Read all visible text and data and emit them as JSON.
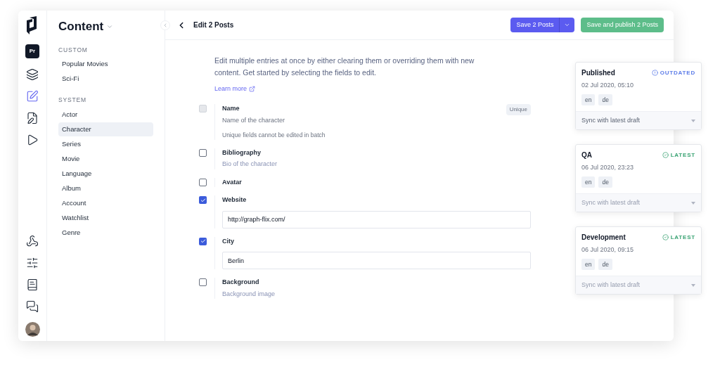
{
  "project_badge": "Pr",
  "nav": {
    "title": "Content",
    "sections": [
      {
        "heading": "CUSTOM",
        "items": [
          {
            "label": "Popular Movies",
            "selected": false
          },
          {
            "label": "Sci-Fi",
            "selected": false
          }
        ]
      },
      {
        "heading": "SYSTEM",
        "items": [
          {
            "label": "Actor",
            "selected": false
          },
          {
            "label": "Character",
            "selected": true
          },
          {
            "label": "Series",
            "selected": false
          },
          {
            "label": "Movie",
            "selected": false
          },
          {
            "label": "Language",
            "selected": false
          },
          {
            "label": "Album",
            "selected": false
          },
          {
            "label": "Account",
            "selected": false
          },
          {
            "label": "Watchlist",
            "selected": false
          },
          {
            "label": "Genre",
            "selected": false
          }
        ]
      }
    ]
  },
  "header": {
    "title": "Edit 2 Posts",
    "save_button": "Save 2 Posts",
    "publish_button": "Save and publish 2 Posts"
  },
  "intro": "Edit multiple entries at once by either clearing them or overriding them with new content. Get started by selecting the fields to edit.",
  "learn_more": "Learn more",
  "fields": [
    {
      "label": "Name",
      "description": "Name of the character",
      "checked": false,
      "disabled": true,
      "badge": "Unique",
      "note": "Unique fields cannot be edited in batch"
    },
    {
      "label": "Bibliography",
      "description": "Bio of the character",
      "checked": false,
      "disabled": false
    },
    {
      "label": "Avatar",
      "checked": false,
      "disabled": false
    },
    {
      "label": "Website",
      "checked": true,
      "disabled": false,
      "value": "http://graph-flix.com/"
    },
    {
      "label": "City",
      "checked": true,
      "disabled": false,
      "value": "Berlin"
    },
    {
      "label": "Background",
      "description": "Background image",
      "checked": false,
      "disabled": false
    }
  ],
  "stages": [
    {
      "name": "Published",
      "status": "OUTDATED",
      "kind": "outdated",
      "date": "02 Jul 2020, 05:10",
      "locales": [
        "en",
        "de"
      ],
      "sync": "Sync with latest draft",
      "disabled": false
    },
    {
      "name": "QA",
      "status": "LATEST",
      "kind": "latest",
      "date": "06 Jul 2020, 23:23",
      "locales": [
        "en",
        "de"
      ],
      "sync": "Sync with latest draft",
      "disabled": true
    },
    {
      "name": "Development",
      "status": "LATEST",
      "kind": "latest",
      "date": "06 Jul 2020, 09:15",
      "locales": [
        "en",
        "de"
      ],
      "sync": "Sync with latest draft",
      "disabled": true
    }
  ]
}
